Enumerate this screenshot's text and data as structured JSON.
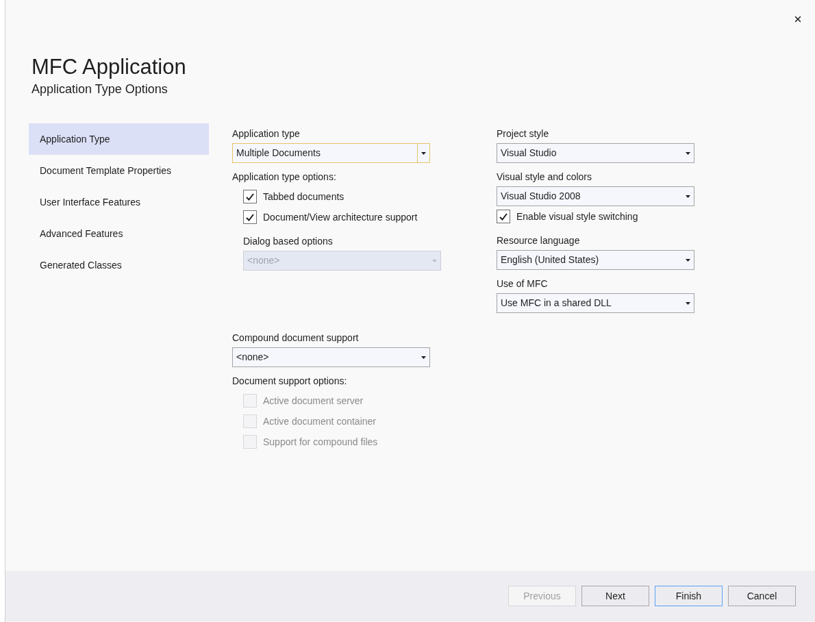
{
  "header": {
    "title": "MFC Application",
    "subtitle": "Application Type Options"
  },
  "sidebar": {
    "items": [
      {
        "label": "Application Type",
        "selected": true
      },
      {
        "label": "Document Template Properties",
        "selected": false
      },
      {
        "label": "User Interface Features",
        "selected": false
      },
      {
        "label": "Advanced Features",
        "selected": false
      },
      {
        "label": "Generated Classes",
        "selected": false
      }
    ]
  },
  "middle": {
    "sections": [
      {
        "items": [
          {
            "kind": "label",
            "text": "Application type"
          },
          {
            "kind": "dropdown",
            "value": "Multiple Documents",
            "focused": true,
            "disabled": false
          },
          {
            "kind": "label",
            "text": "Application type options:",
            "children": [
              {
                "kind": "checkbox",
                "label": "Tabbed documents",
                "checked": true,
                "disabled": false
              },
              {
                "kind": "checkbox",
                "label": "Document/View architecture support",
                "checked": true,
                "disabled": false
              },
              {
                "kind": "label",
                "text": "Dialog based options"
              },
              {
                "kind": "dropdown",
                "value": "<none>",
                "focused": false,
                "disabled": true
              }
            ]
          }
        ]
      },
      {
        "items": [
          {
            "kind": "label",
            "text": "Compound document support"
          },
          {
            "kind": "dropdown",
            "value": "<none>",
            "focused": false,
            "disabled": false
          },
          {
            "kind": "label",
            "text": "Document support options:",
            "children": [
              {
                "kind": "checkbox",
                "label": "Active document server",
                "checked": false,
                "disabled": true
              },
              {
                "kind": "checkbox",
                "label": "Active document container",
                "checked": false,
                "disabled": true
              },
              {
                "kind": "checkbox",
                "label": "Support for compound files",
                "checked": false,
                "disabled": true
              }
            ]
          }
        ]
      }
    ]
  },
  "right": {
    "items": [
      {
        "kind": "label",
        "text": "Project style"
      },
      {
        "kind": "dropdown",
        "value": "Visual Studio",
        "focused": false,
        "disabled": false
      },
      {
        "kind": "label",
        "text": "Visual style and colors"
      },
      {
        "kind": "dropdown",
        "value": "Visual Studio 2008",
        "focused": false,
        "disabled": false
      },
      {
        "kind": "checkbox",
        "label": "Enable visual style switching",
        "checked": true,
        "disabled": false
      },
      {
        "kind": "label",
        "text": "Resource language"
      },
      {
        "kind": "dropdown",
        "value": "English (United States)",
        "focused": false,
        "disabled": false
      },
      {
        "kind": "label",
        "text": "Use of MFC"
      },
      {
        "kind": "dropdown",
        "value": "Use MFC in a shared DLL",
        "focused": false,
        "disabled": false
      }
    ]
  },
  "buttons": [
    {
      "label": "Previous",
      "disabled": true,
      "default": false
    },
    {
      "label": "Next",
      "disabled": false,
      "default": false
    },
    {
      "label": "Finish",
      "disabled": false,
      "default": true
    },
    {
      "label": "Cancel",
      "disabled": false,
      "default": false
    }
  ]
}
